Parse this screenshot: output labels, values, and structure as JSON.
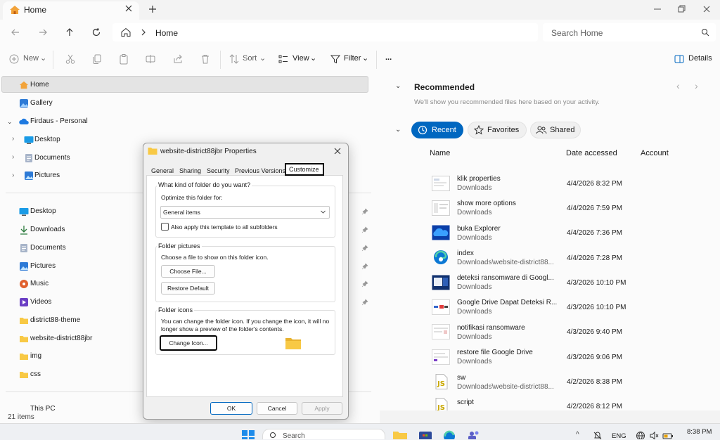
{
  "window": {
    "tab_title": "Home",
    "address_current": "Home",
    "search_placeholder": "Search Home"
  },
  "commandbar": {
    "new_label": "New",
    "sort_label": "Sort",
    "view_label": "View",
    "filter_label": "Filter",
    "more_label": "...",
    "details_label": "Details"
  },
  "nav": {
    "home": "Home",
    "gallery": "Gallery",
    "onedrive": "Firdaus - Personal",
    "onedrive_children": [
      "Desktop",
      "Documents",
      "Pictures"
    ],
    "quick_access": [
      "Desktop",
      "Downloads",
      "Documents",
      "Pictures",
      "Music",
      "Videos",
      "district88-theme",
      "website-district88jbr",
      "img",
      "css"
    ],
    "this_pc": "This PC"
  },
  "status": {
    "items_count": "21 items"
  },
  "recommended": {
    "title": "Recommended",
    "subtitle": "We'll show you recommended files here based on your activity."
  },
  "filters": {
    "recent": "Recent",
    "favorites": "Favorites",
    "shared": "Shared"
  },
  "columns": {
    "name": "Name",
    "date": "Date accessed",
    "account": "Account"
  },
  "files": [
    {
      "name": "klik properties",
      "location": "Downloads",
      "date": "4/4/2026 8:32 PM"
    },
    {
      "name": "show more options",
      "location": "Downloads",
      "date": "4/4/2026 7:59 PM"
    },
    {
      "name": "buka Explorer",
      "location": "Downloads",
      "date": "4/4/2026 7:36 PM"
    },
    {
      "name": "index",
      "location": "Downloads\\website-district88...",
      "date": "4/4/2026 7:28 PM"
    },
    {
      "name": "deteksi ransomware di Googl...",
      "location": "Downloads",
      "date": "4/3/2026 10:10 PM"
    },
    {
      "name": "Google Drive Dapat Deteksi R...",
      "location": "Downloads",
      "date": "4/3/2026 10:10 PM"
    },
    {
      "name": "notifikasi ransomware",
      "location": "Downloads",
      "date": "4/3/2026 9:40 PM"
    },
    {
      "name": "restore file Google Drive",
      "location": "Downloads",
      "date": "4/3/2026 9:06 PM"
    },
    {
      "name": "sw",
      "location": "Downloads\\website-district88...",
      "date": "4/2/2026 8:38 PM"
    },
    {
      "name": "script",
      "location": "",
      "date": "4/2/2026 8:12 PM"
    }
  ],
  "dialog": {
    "title": "website-district88jbr Properties",
    "tabs": [
      "General",
      "Sharing",
      "Security",
      "Previous Versions",
      "Customize"
    ],
    "group1_title": "What kind of folder do you want?",
    "optimize_label": "Optimize this folder for:",
    "optimize_value": "General items",
    "apply_subfolders": "Also apply this template to all subfolders",
    "group2_title": "Folder pictures",
    "choose_text": "Choose a file to show on this folder icon.",
    "choose_btn": "Choose File...",
    "restore_btn": "Restore Default",
    "group3_title": "Folder icons",
    "icons_text1": "You can change the folder icon. If you change the icon, it will no",
    "icons_text2": "longer show a preview of the folder's contents.",
    "change_icon_btn": "Change Icon...",
    "ok_btn": "OK",
    "cancel_btn": "Cancel",
    "apply_btn": "Apply"
  },
  "taskbar": {
    "search_placeholder": "Search",
    "language": "ENG",
    "time": "8:38 PM"
  },
  "colors": {
    "accent": "#0067c0",
    "folder": "#f8c945"
  }
}
